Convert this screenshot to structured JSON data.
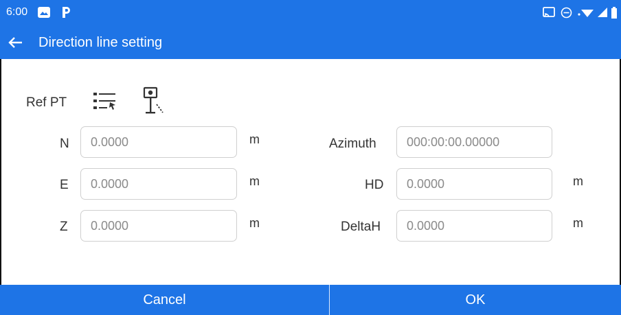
{
  "status_bar": {
    "time": "6:00",
    "icons": [
      "gallery-icon",
      "parking-icon",
      "cast-icon",
      "do-not-disturb-icon",
      "wifi-icon",
      "signal-icon",
      "battery-icon"
    ]
  },
  "app_bar": {
    "back_icon": "arrow-left-icon",
    "title": "Direction line setting"
  },
  "ref_pt": {
    "label": "Ref PT",
    "icons": [
      "point-list-select-icon",
      "survey-stake-icon"
    ]
  },
  "left_fields": [
    {
      "label": "N",
      "value": "",
      "placeholder": "0.0000",
      "unit": "m"
    },
    {
      "label": "E",
      "value": "",
      "placeholder": "0.0000",
      "unit": "m"
    },
    {
      "label": "Z",
      "value": "",
      "placeholder": "0.0000",
      "unit": "m"
    }
  ],
  "right_fields": [
    {
      "label": "Azimuth",
      "value": "",
      "placeholder": "000:00:00.00000",
      "unit": ""
    },
    {
      "label": "HD",
      "value": "",
      "placeholder": "0.0000",
      "unit": "m"
    },
    {
      "label": "DeltaH",
      "value": "",
      "placeholder": "0.0000",
      "unit": "m"
    }
  ],
  "buttons": {
    "cancel": "Cancel",
    "ok": "OK"
  },
  "colors": {
    "primary": "#1e74e6",
    "field_border": "#cfcfcf",
    "text": "#333333",
    "placeholder": "#8a8a8a"
  }
}
